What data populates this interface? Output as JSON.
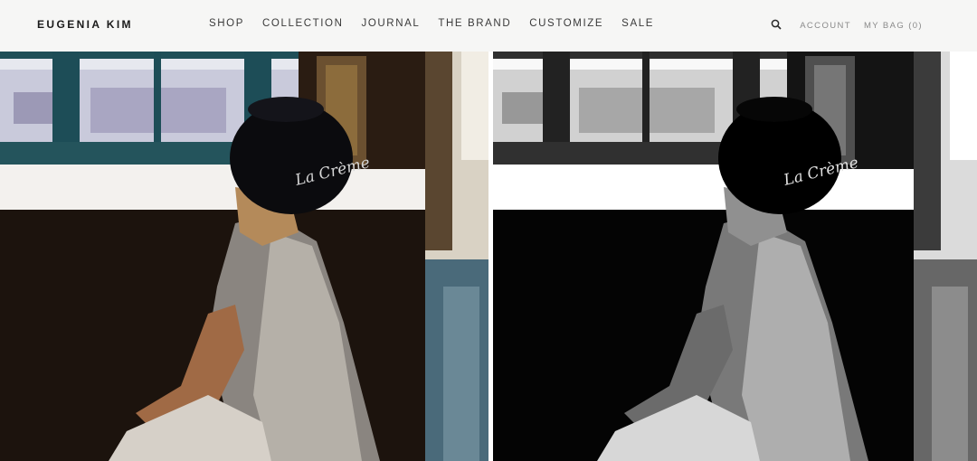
{
  "brand": {
    "logo_text": "EUGENIA KIM"
  },
  "nav": {
    "items": [
      {
        "label": "SHOP"
      },
      {
        "label": "COLLECTION"
      },
      {
        "label": "JOURNAL"
      },
      {
        "label": "THE BRAND"
      },
      {
        "label": "CUSTOMIZE"
      },
      {
        "label": "SALE"
      }
    ]
  },
  "utility": {
    "search_icon": "search-icon",
    "account_label": "ACCOUNT",
    "bag_label": "MY BAG (0)"
  },
  "hero": {
    "hat_text": "La Crème",
    "panels": [
      {
        "variant": "color"
      },
      {
        "variant": "black-and-white"
      }
    ]
  },
  "colors": {
    "header_bg": "#f6f6f5",
    "logo": "#1a1a1a",
    "nav_text": "#3a3a3a",
    "utility_text": "#8a8a8a",
    "window_frame": "#1d4d57"
  }
}
